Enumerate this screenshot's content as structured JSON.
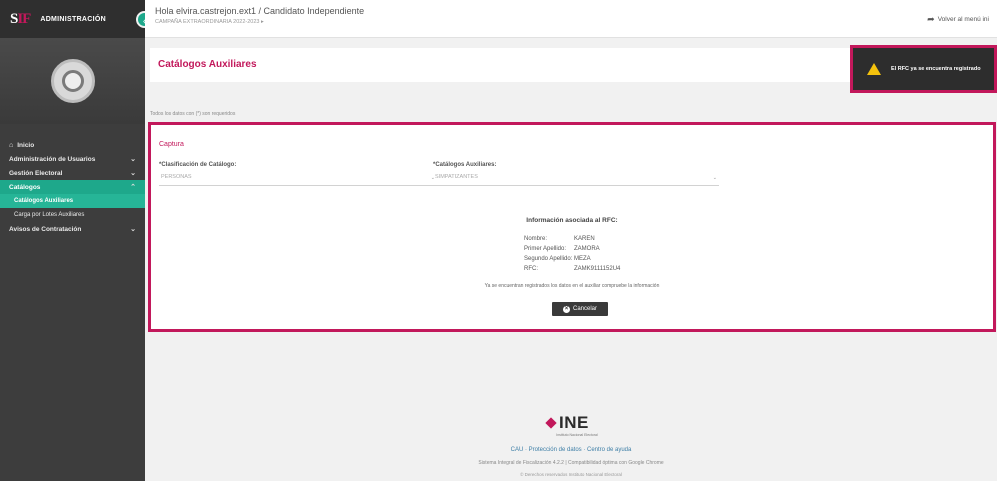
{
  "app": {
    "logo_left": "S",
    "logo_accent": "IF",
    "brand_title": "ADMINISTRACIÓN"
  },
  "header": {
    "greeting": "Hola elvira.castrejon.ext1 / Candidato Independiente",
    "subtitle": "CAMPAÑA EXTRAORDINARIA 2022-2023 ▸",
    "back_label": "Volver al menú ini"
  },
  "sidebar": {
    "items": [
      {
        "label": "Inicio"
      },
      {
        "label": "Administración de Usuarios"
      },
      {
        "label": "Gestión Electoral"
      },
      {
        "label": "Catálogos"
      },
      {
        "label": "Catálogos Auxiliares"
      },
      {
        "label": "Carga por Lotes Auxiliares"
      },
      {
        "label": "Avisos de Contratación"
      }
    ]
  },
  "page": {
    "title": "Catálogos Auxiliares",
    "help_text": "Todos los datos con (*) son requeridos"
  },
  "toast": {
    "message": "El RFC ya se encuentra registrado"
  },
  "form": {
    "section_title": "Captura",
    "classification_label": "*Clasificación de Catálogo:",
    "classification_value": "PERSONAS",
    "aux_label": "*Catálogos Auxiliares:",
    "aux_value": "SIMPATIZANTES",
    "info_title": "Información asociada al RFC:",
    "info": [
      {
        "label": "Nombre:",
        "value": "KAREN"
      },
      {
        "label": "Primer Apellido:",
        "value": "ZAMORA"
      },
      {
        "label": "Segundo Apellido:",
        "value": "MEZA"
      },
      {
        "label": "RFC:",
        "value": "ZAMK9111152U4"
      }
    ],
    "note": "Ya se encuentran registrados los datos en el auxiliar compruebe la información",
    "cancel_label": "Cancelar",
    "cancel_icon": "×"
  },
  "footer": {
    "logo": "INE",
    "logo_sub": "Instituto Nacional Electoral",
    "links": "CAU · Protección de datos · Centro de ayuda",
    "line2": "Sistema Integral de Fiscalización 4.2.2 | Compatibilidad óptima con Google Chrome",
    "line3": "© Derechos reservados Instituto Nacional Electoral"
  },
  "colors": {
    "accent": "#c2185b",
    "sidebar_bg": "#3d3d3d",
    "active": "#1ea88b",
    "warning": "#f4c20d"
  }
}
